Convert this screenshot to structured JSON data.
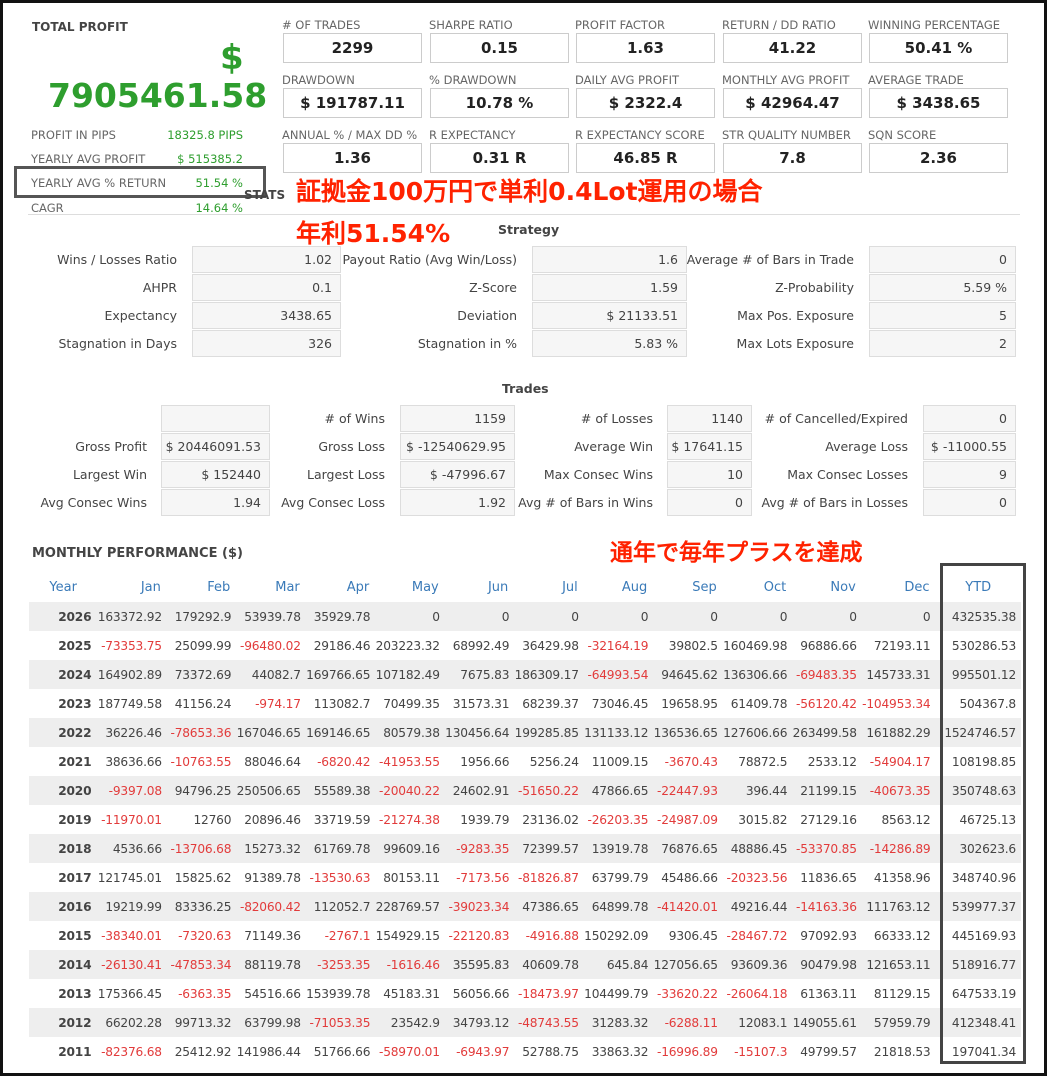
{
  "total_profit": {
    "label": "TOTAL PROFIT",
    "currency": "$",
    "value": "7905461.58"
  },
  "left_stats": [
    {
      "label": "PROFIT IN PIPS",
      "value": "18325.8 PIPS"
    },
    {
      "label": "YEARLY AVG PROFIT",
      "value": "$ 515385.2"
    },
    {
      "label": "YEARLY AVG % RETURN",
      "value": "51.54 %"
    },
    {
      "label": "CAGR",
      "value": "14.64 %"
    }
  ],
  "metrics": [
    {
      "label": "# OF TRADES",
      "value": "2299"
    },
    {
      "label": "SHARPE RATIO",
      "value": "0.15"
    },
    {
      "label": "PROFIT FACTOR",
      "value": "1.63"
    },
    {
      "label": "RETURN / DD RATIO",
      "value": "41.22"
    },
    {
      "label": "WINNING PERCENTAGE",
      "value": "50.41 %"
    },
    {
      "label": "DRAWDOWN",
      "value": "$ 191787.11"
    },
    {
      "label": "% DRAWDOWN",
      "value": "10.78 %"
    },
    {
      "label": "DAILY AVG PROFIT",
      "value": "$ 2322.4"
    },
    {
      "label": "MONTHLY AVG PROFIT",
      "value": "$ 42964.47"
    },
    {
      "label": "AVERAGE TRADE",
      "value": "$ 3438.65"
    },
    {
      "label": "ANNUAL % / MAX DD %",
      "value": "1.36"
    },
    {
      "label": "R EXPECTANCY",
      "value": "0.31 R"
    },
    {
      "label": "R EXPECTANCY SCORE",
      "value": "46.85 R"
    },
    {
      "label": "STR QUALITY NUMBER",
      "value": "7.8"
    },
    {
      "label": "SQN SCORE",
      "value": "2.36"
    }
  ],
  "annotations": {
    "line1": "証拠金100万円で単利0.4Lot運用の場合",
    "line2": "年利51.54%",
    "line3": "通年で毎年プラスを達成"
  },
  "stats_label": "STATS",
  "strategy": {
    "title": "Strategy",
    "rows": [
      [
        {
          "label": "Wins / Losses Ratio",
          "value": "1.02"
        },
        {
          "label": "Payout Ratio (Avg Win/Loss)",
          "value": "1.6"
        },
        {
          "label": "Average # of Bars in Trade",
          "value": "0"
        }
      ],
      [
        {
          "label": "AHPR",
          "value": "0.1"
        },
        {
          "label": "Z-Score",
          "value": "1.59"
        },
        {
          "label": "Z-Probability",
          "value": "5.59 %"
        }
      ],
      [
        {
          "label": "Expectancy",
          "value": "3438.65"
        },
        {
          "label": "Deviation",
          "value": "$ 21133.51"
        },
        {
          "label": "Max Pos. Exposure",
          "value": "5"
        }
      ],
      [
        {
          "label": "Stagnation in Days",
          "value": "326"
        },
        {
          "label": "Stagnation in %",
          "value": "5.83 %"
        },
        {
          "label": "Max Lots Exposure",
          "value": "2"
        }
      ]
    ]
  },
  "trades": {
    "title": "Trades",
    "rows": [
      [
        {
          "label": "",
          "value": ""
        },
        {
          "label": "# of Wins",
          "value": "1159"
        },
        {
          "label": "# of Losses",
          "value": "1140"
        },
        {
          "label": "# of Cancelled/Expired",
          "value": "0"
        }
      ],
      [
        {
          "label": "Gross Profit",
          "value": "$ 20446091.53"
        },
        {
          "label": "Gross Loss",
          "value": "$ -12540629.95"
        },
        {
          "label": "Average Win",
          "value": "$ 17641.15"
        },
        {
          "label": "Average Loss",
          "value": "$ -11000.55"
        }
      ],
      [
        {
          "label": "Largest Win",
          "value": "$ 152440"
        },
        {
          "label": "Largest Loss",
          "value": "$ -47996.67"
        },
        {
          "label": "Max Consec Wins",
          "value": "10"
        },
        {
          "label": "Max Consec Losses",
          "value": "9"
        }
      ],
      [
        {
          "label": "Avg Consec Wins",
          "value": "1.94"
        },
        {
          "label": "Avg Consec Loss",
          "value": "1.92"
        },
        {
          "label": "Avg # of Bars in Wins",
          "value": "0"
        },
        {
          "label": "Avg # of Bars in Losses",
          "value": "0"
        }
      ]
    ]
  },
  "monthly": {
    "title": "MONTHLY PERFORMANCE ($)",
    "headers": [
      "Year",
      "Jan",
      "Feb",
      "Mar",
      "Apr",
      "May",
      "Jun",
      "Jul",
      "Aug",
      "Sep",
      "Oct",
      "Nov",
      "Dec",
      "YTD"
    ],
    "rows": [
      [
        "2026",
        "163372.92",
        "179292.9",
        "53939.78",
        "35929.78",
        "0",
        "0",
        "0",
        "0",
        "0",
        "0",
        "0",
        "0",
        "432535.38"
      ],
      [
        "2025",
        "-73353.75",
        "25099.99",
        "-96480.02",
        "29186.46",
        "203223.32",
        "68992.49",
        "36429.98",
        "-32164.19",
        "39802.5",
        "160469.98",
        "96886.66",
        "72193.11",
        "530286.53"
      ],
      [
        "2024",
        "164902.89",
        "73372.69",
        "44082.7",
        "169766.65",
        "107182.49",
        "7675.83",
        "186309.17",
        "-64993.54",
        "94645.62",
        "136306.66",
        "-69483.35",
        "145733.31",
        "995501.12"
      ],
      [
        "2023",
        "187749.58",
        "41156.24",
        "-974.17",
        "113082.7",
        "70499.35",
        "31573.31",
        "68239.37",
        "73046.45",
        "19658.95",
        "61409.78",
        "-56120.42",
        "-104953.34",
        "504367.8"
      ],
      [
        "2022",
        "36226.46",
        "-78653.36",
        "167046.65",
        "169146.65",
        "80579.38",
        "130456.64",
        "199285.85",
        "131133.12",
        "136536.65",
        "127606.66",
        "263499.58",
        "161882.29",
        "1524746.57"
      ],
      [
        "2021",
        "38636.66",
        "-10763.55",
        "88046.64",
        "-6820.42",
        "-41953.55",
        "1956.66",
        "5256.24",
        "11009.15",
        "-3670.43",
        "78872.5",
        "2533.12",
        "-54904.17",
        "108198.85"
      ],
      [
        "2020",
        "-9397.08",
        "94796.25",
        "250506.65",
        "55589.38",
        "-20040.22",
        "24602.91",
        "-51650.22",
        "47866.65",
        "-22447.93",
        "396.44",
        "21199.15",
        "-40673.35",
        "350748.63"
      ],
      [
        "2019",
        "-11970.01",
        "12760",
        "20896.46",
        "33719.59",
        "-21274.38",
        "1939.79",
        "23136.02",
        "-26203.35",
        "-24987.09",
        "3015.82",
        "27129.16",
        "8563.12",
        "46725.13"
      ],
      [
        "2018",
        "4536.66",
        "-13706.68",
        "15273.32",
        "61769.78",
        "99609.16",
        "-9283.35",
        "72399.57",
        "13919.78",
        "76876.65",
        "48886.45",
        "-53370.85",
        "-14286.89",
        "302623.6"
      ],
      [
        "2017",
        "121745.01",
        "15825.62",
        "91389.78",
        "-13530.63",
        "80153.11",
        "-7173.56",
        "-81826.87",
        "63799.79",
        "45486.66",
        "-20323.56",
        "11836.65",
        "41358.96",
        "348740.96"
      ],
      [
        "2016",
        "19219.99",
        "83336.25",
        "-82060.42",
        "112052.7",
        "228769.57",
        "-39023.34",
        "47386.65",
        "64899.78",
        "-41420.01",
        "49216.44",
        "-14163.36",
        "111763.12",
        "539977.37"
      ],
      [
        "2015",
        "-38340.01",
        "-7320.63",
        "71149.36",
        "-2767.1",
        "154929.15",
        "-22120.83",
        "-4916.88",
        "150292.09",
        "9306.45",
        "-28467.72",
        "97092.93",
        "66333.12",
        "445169.93"
      ],
      [
        "2014",
        "-26130.41",
        "-47853.34",
        "88119.78",
        "-3253.35",
        "-1616.46",
        "35595.83",
        "40609.78",
        "645.84",
        "127056.65",
        "93609.36",
        "90479.98",
        "121653.11",
        "518916.77"
      ],
      [
        "2013",
        "175366.45",
        "-6363.35",
        "54516.66",
        "153939.78",
        "45183.31",
        "56056.66",
        "-18473.97",
        "104499.79",
        "-33620.22",
        "-26064.18",
        "61363.11",
        "81129.15",
        "647533.19"
      ],
      [
        "2012",
        "66202.28",
        "99713.32",
        "63799.98",
        "-71053.35",
        "23542.9",
        "34793.12",
        "-48743.55",
        "31283.32",
        "-6288.11",
        "12083.1",
        "149055.61",
        "57959.79",
        "412348.41"
      ],
      [
        "2011",
        "-82376.68",
        "25412.92",
        "141986.44",
        "51766.66",
        "-58970.01",
        "-6943.97",
        "52788.75",
        "33863.32",
        "-16996.89",
        "-15107.3",
        "49799.57",
        "21818.53",
        "197041.34"
      ]
    ]
  }
}
